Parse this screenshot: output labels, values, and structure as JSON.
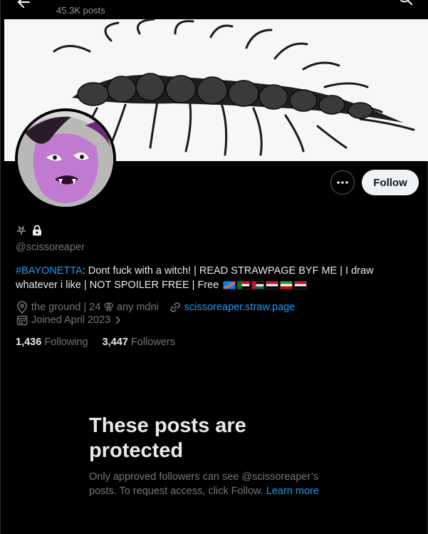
{
  "header": {
    "post_count": "45.3K posts"
  },
  "profile": {
    "handle": "@scissoreaper",
    "name_symbol": "⛧",
    "bio": {
      "hashtag": "#BAYONETTA",
      "text": ": Dont fuck with a witch! | READ STRAWPAGE BYF ME | I draw whatever i like | NOT SPOILER FREE | Free"
    },
    "location": "the ground | 24 ⚢ any mdni",
    "website": "scissoreaper.straw.page",
    "joined": "Joined April 2023",
    "following_count": "1,436",
    "following_label": "Following",
    "followers_count": "3,447",
    "followers_label": "Followers"
  },
  "actions": {
    "follow_label": "Follow"
  },
  "protected": {
    "title": "These posts are protected",
    "body": "Only approved followers can see @scissoreaper’s posts. To request access, click Follow.",
    "learn_more": "Learn more"
  },
  "colors": {
    "accent": "#1d9bf0",
    "background": "#000000",
    "text_primary": "#e7e9ea",
    "text_secondary": "#71767b"
  },
  "icons": [
    "back-arrow-icon",
    "search-icon",
    "more-icon",
    "pentagram-icon",
    "lock-icon",
    "location-icon",
    "link-icon",
    "calendar-icon",
    "chevron-right-icon"
  ]
}
